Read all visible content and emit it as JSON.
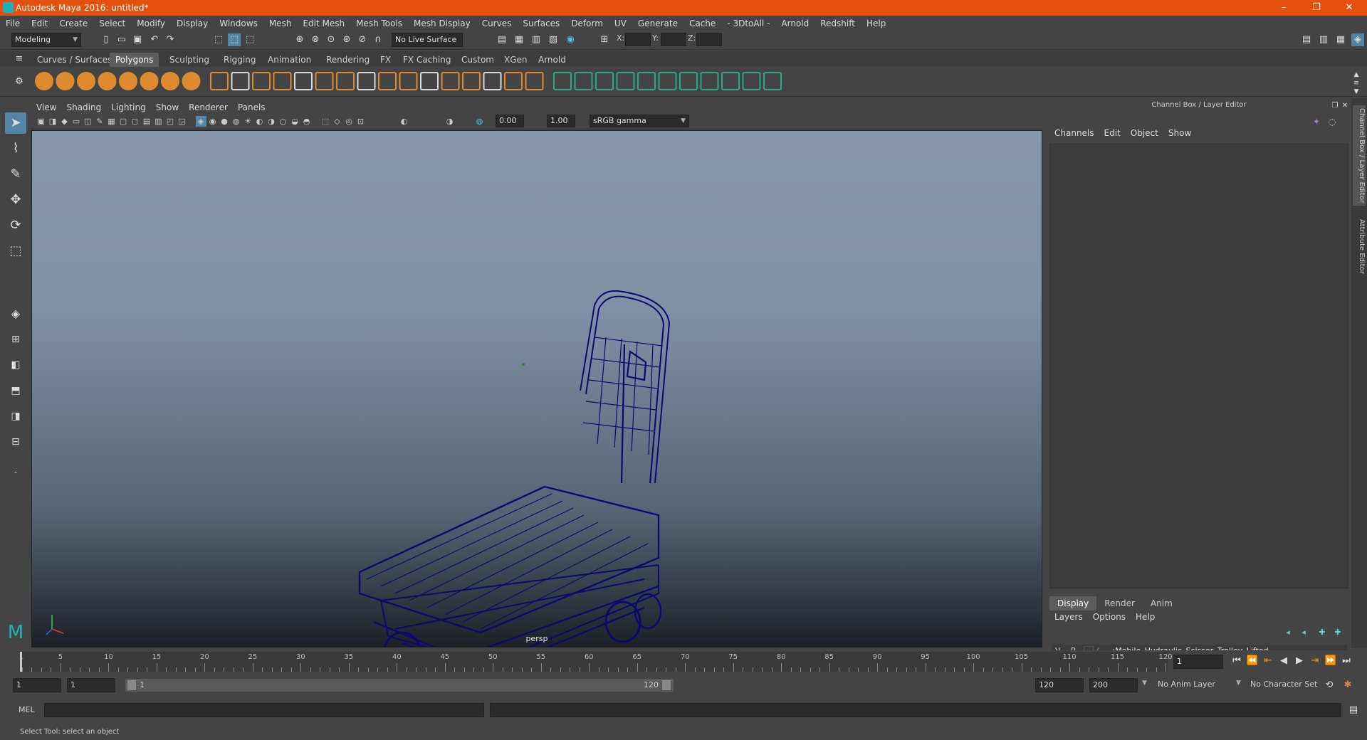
{
  "window": {
    "title": "Autodesk Maya 2016: untitled*",
    "controls": [
      "–",
      "❐",
      "✕"
    ]
  },
  "menubar": [
    "File",
    "Edit",
    "Create",
    "Select",
    "Modify",
    "Display",
    "Windows",
    "Mesh",
    "Edit Mesh",
    "Mesh Tools",
    "Mesh Display",
    "Curves",
    "Surfaces",
    "Deform",
    "UV",
    "Generate",
    "Cache",
    "- 3DtoAll -",
    "Arnold",
    "Redshift",
    "Help"
  ],
  "statusline": {
    "mode": "Modeling",
    "live_surface": "No Live Surface",
    "x_label": "X:",
    "y_label": "Y:",
    "z_label": "Z:"
  },
  "shelf_tabs": [
    {
      "label": "Curves / Surfaces",
      "active": false
    },
    {
      "label": "Polygons",
      "active": true
    },
    {
      "label": "Sculpting",
      "active": false
    },
    {
      "label": "Rigging",
      "active": false
    },
    {
      "label": "Animation",
      "active": false
    },
    {
      "label": "Rendering",
      "active": false
    },
    {
      "label": "FX",
      "active": false
    },
    {
      "label": "FX Caching",
      "active": false
    },
    {
      "label": "Custom",
      "active": false
    },
    {
      "label": "XGen",
      "active": false
    },
    {
      "label": "Arnold",
      "active": false
    }
  ],
  "viewport": {
    "menu": [
      "View",
      "Shading",
      "Lighting",
      "Show",
      "Renderer",
      "Panels"
    ],
    "exposure": "0.00",
    "gamma": "1.00",
    "color_space": "sRGB gamma",
    "camera": "persp",
    "wire_color": "#0a0a6e"
  },
  "channelbox": {
    "title": "Channel Box / Layer Editor",
    "menu": [
      "Channels",
      "Edit",
      "Object",
      "Show"
    ],
    "tabs": [
      {
        "label": "Display",
        "active": true
      },
      {
        "label": "Render",
        "active": false
      },
      {
        "label": "Anim",
        "active": false
      }
    ],
    "layer_menu": [
      "Layers",
      "Options",
      "Help"
    ],
    "layer": {
      "v": "V",
      "p": "P",
      "name": "...:Mobile_Hydraulic_Scissor_Trolley_Lifted"
    }
  },
  "side_tabs": [
    "Channel Box / Layer Editor",
    "Attribute Editor"
  ],
  "timeline": {
    "ticks": [
      "5",
      "10",
      "15",
      "20",
      "25",
      "30",
      "35",
      "40",
      "45",
      "50",
      "55",
      "60",
      "65",
      "70",
      "75",
      "80",
      "85",
      "90",
      "95",
      "100",
      "105",
      "110",
      "115",
      "120"
    ],
    "start_label": "1",
    "current_frame": "1"
  },
  "range": {
    "start": "1",
    "anim_start": "1",
    "slider_start": "1",
    "slider_end": "120",
    "anim_end": "120",
    "end": "200",
    "anim_layer": "No Anim Layer",
    "char_set": "No Character Set"
  },
  "cmdline": {
    "label": "MEL"
  },
  "helpline": {
    "text": "Select Tool: select an object"
  }
}
